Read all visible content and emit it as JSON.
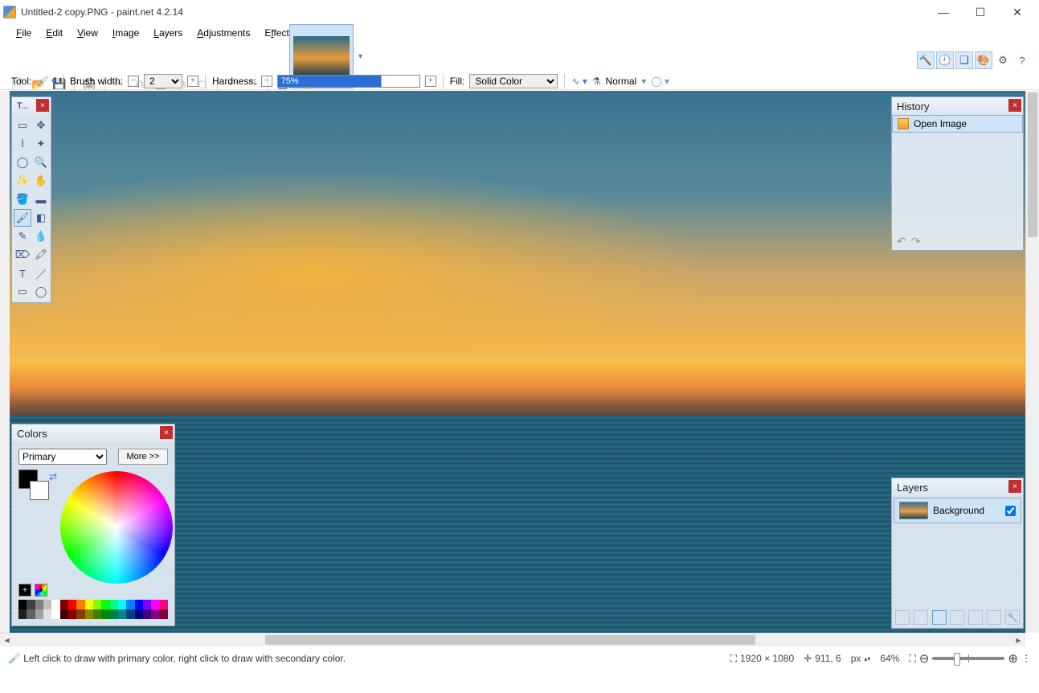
{
  "title": "Untitled-2 copy.PNG - paint.net 4.2.14",
  "menus": [
    "File",
    "Edit",
    "View",
    "Image",
    "Layers",
    "Adjustments",
    "Effects"
  ],
  "menu_underline_idx": [
    0,
    0,
    0,
    0,
    0,
    0,
    1
  ],
  "toolbar2": {
    "new": "new-file",
    "open": "open-folder",
    "save": "save",
    "print": "print",
    "cut": "cut",
    "copy": "copy",
    "paste": "paste",
    "crop": "crop",
    "deselect": "deselect",
    "undo": "undo",
    "redo": "redo",
    "grid": "grid",
    "ruler": "ruler"
  },
  "optbar": {
    "tool_label": "Tool:",
    "brush_label": "Brush width:",
    "brush_value": "2",
    "hardness_label": "Hardness:",
    "hardness_value": "75%",
    "fill_label": "Fill:",
    "fill_value": "Solid Color",
    "blend_label": "Normal"
  },
  "tools_panel": {
    "title": "T...",
    "items": [
      "rectangle-select",
      "move-selected",
      "lasso-select",
      "move-selection",
      "ellipse-select",
      "zoom",
      "magic-wand",
      "pan",
      "paint-bucket",
      "gradient",
      "paintbrush",
      "eraser",
      "pencil",
      "color-picker",
      "clone-stamp",
      "recolor",
      "text",
      "line",
      "rectangle-shape",
      "ellipse-shape"
    ],
    "selected_index": 10
  },
  "history_panel": {
    "title": "History",
    "items": [
      "Open Image"
    ]
  },
  "layers_panel": {
    "title": "Layers",
    "rows": [
      {
        "name": "Background",
        "checked": true
      }
    ]
  },
  "colors_panel": {
    "title": "Colors",
    "selector": "Primary",
    "more": "More >>",
    "palette_row1": [
      "#000",
      "#404040",
      "#808080",
      "#c0c0c0",
      "#fff",
      "#800000",
      "#f00",
      "#ff8000",
      "#ff0",
      "#80ff00",
      "#0f0",
      "#00ff80",
      "#0ff",
      "#0080ff",
      "#00f",
      "#8000ff",
      "#f0f",
      "#ff0080"
    ],
    "palette_row2": [
      "#202020",
      "#606060",
      "#a0a0a0",
      "#e0e0e0",
      "#fff",
      "#400000",
      "#800",
      "#804000",
      "#880",
      "#408000",
      "#080",
      "#008040",
      "#088",
      "#004080",
      "#008",
      "#400080",
      "#808",
      "#800040"
    ]
  },
  "status": {
    "hint": "Left click to draw with primary color, right click to draw with secondary color.",
    "dims": "1920 × 1080",
    "cursor": "911, 6",
    "unit": "px",
    "zoom": "64%"
  },
  "aux_btns": [
    "tools",
    "history",
    "layers",
    "colors",
    "settings",
    "help"
  ]
}
